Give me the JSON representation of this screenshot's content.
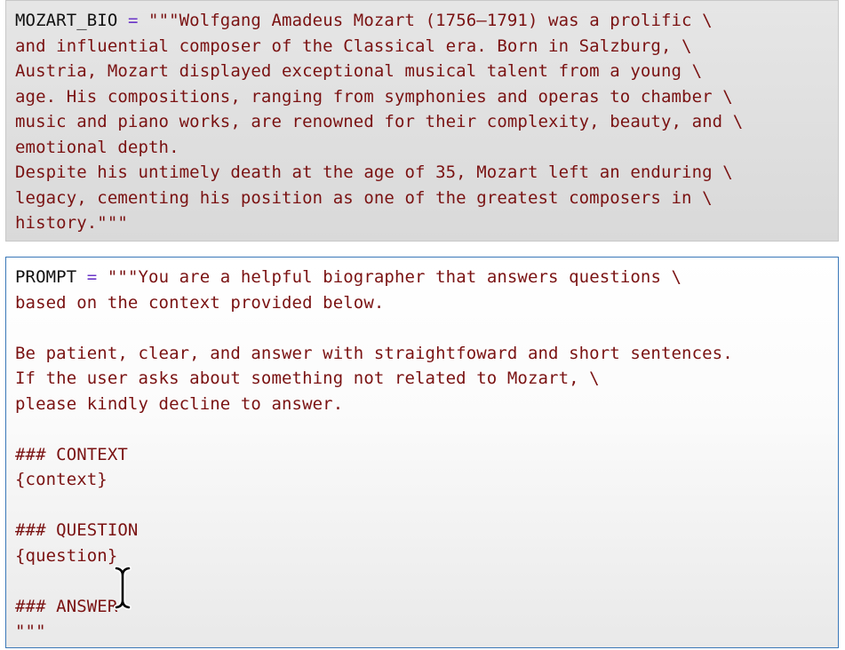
{
  "colors": {
    "variable": "#111111",
    "operator": "#6a35c7",
    "string": "#7a1212",
    "active_cell_border": "#3a78b8"
  },
  "cells": [
    {
      "variable": "MOZART_BIO",
      "operator": "=",
      "string_lines": [
        "\"\"\"Wolfgang Amadeus Mozart (1756–1791) was a prolific \\",
        "and influential composer of the Classical era. Born in Salzburg, \\",
        "Austria, Mozart displayed exceptional musical talent from a young \\",
        "age. His compositions, ranging from symphonies and operas to chamber \\",
        "music and piano works, are renowned for their complexity, beauty, and \\",
        "emotional depth.",
        "Despite his untimely death at the age of 35, Mozart left an enduring \\",
        "legacy, cementing his position as one of the greatest composers in \\",
        "history.\"\"\""
      ]
    },
    {
      "variable": "PROMPT",
      "operator": "=",
      "string_lines": [
        "\"\"\"You are a helpful biographer that answers questions \\",
        "based on the context provided below.",
        "",
        "Be patient, clear, and answer with straightfoward and short sentences.",
        "If the user asks about something not related to Mozart, \\",
        "please kindly decline to answer.",
        "",
        "### CONTEXT",
        "{context}",
        "",
        "### QUESTION",
        "{question}",
        "",
        "### ANSWER",
        "\"\"\""
      ]
    }
  ],
  "cursor": {
    "icon": "text-cursor-icon"
  }
}
